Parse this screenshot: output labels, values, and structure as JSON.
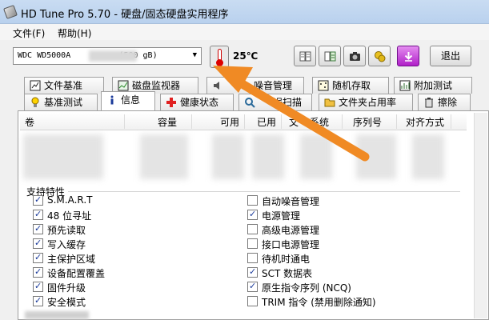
{
  "window": {
    "title": "HD Tune Pro 5.70 - 硬盘/固态硬盘实用程序"
  },
  "menu": {
    "file": "文件(F)",
    "help": "帮助(H)"
  },
  "toolbar": {
    "drive_value": "WDC WD5000A          (500 gB)",
    "temperature": "25℃",
    "exit_label": "退出",
    "icons": [
      "copy-text-icon",
      "copy-info-icon",
      "camera-icon",
      "settings-coins-icon",
      "download-icon"
    ]
  },
  "tabs_top": [
    {
      "label": "文件基准",
      "icon": "benchmark-file-icon"
    },
    {
      "label": "磁盘监视器",
      "icon": "disk-monitor-icon"
    },
    {
      "label": "噪音管理",
      "icon": "aam-icon"
    },
    {
      "label": "随机存取",
      "icon": "random-access-icon"
    },
    {
      "label": "附加测试",
      "icon": "extra-tests-icon"
    }
  ],
  "tabs_bottom": [
    {
      "label": "基准测试",
      "icon": "lightbulb-icon"
    },
    {
      "label": "信息",
      "icon": "info-icon",
      "active": true
    },
    {
      "label": "健康状态",
      "icon": "health-cross-icon"
    },
    {
      "label": "误扫描",
      "icon": "error-scan-icon"
    },
    {
      "label": "文件夹占用率",
      "icon": "folder-icon"
    },
    {
      "label": "擦除",
      "icon": "erase-icon"
    }
  ],
  "table": {
    "columns": [
      "卷",
      "容量",
      "可用",
      "已用",
      "文",
      "系统",
      "序列号",
      "对齐方式"
    ]
  },
  "features": {
    "title": "支持特性",
    "left": [
      {
        "label": "S.M.A.R.T",
        "checked": true
      },
      {
        "label": "48 位寻址",
        "checked": true
      },
      {
        "label": "预先读取",
        "checked": true
      },
      {
        "label": "写入缓存",
        "checked": true
      },
      {
        "label": "主保护区域",
        "checked": true
      },
      {
        "label": "设备配置覆盖",
        "checked": true
      },
      {
        "label": "固件升级",
        "checked": true
      },
      {
        "label": "安全模式",
        "checked": true
      }
    ],
    "right": [
      {
        "label": "自动噪音管理",
        "checked": false
      },
      {
        "label": "电源管理",
        "checked": true
      },
      {
        "label": "高级电源管理",
        "checked": false
      },
      {
        "label": "接口电源管理",
        "checked": false
      },
      {
        "label": "待机时通电",
        "checked": false
      },
      {
        "label": "SCT 数据表",
        "checked": true
      },
      {
        "label": "原生指令序列 (NCQ)",
        "checked": true
      },
      {
        "label": "TRIM 指令 (禁用删除通知)",
        "checked": false
      }
    ]
  },
  "colors": {
    "arrow": "#f08a24",
    "accent": "#1a3a9a",
    "temp_red": "#d00000"
  }
}
